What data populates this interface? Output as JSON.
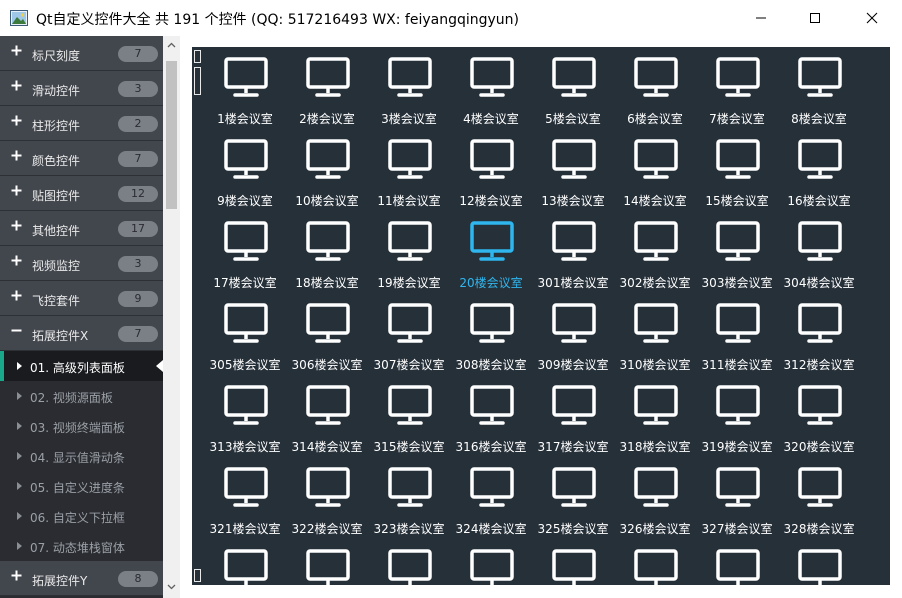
{
  "window": {
    "title": "Qt自定义控件大全 共 191 个控件 (QQ: 517216493 WX: feiyangqingyun)",
    "icon": "app-image-icon",
    "controls": [
      "minimize-icon",
      "maximize-icon",
      "close-icon"
    ]
  },
  "sidebar": {
    "groups_top": [
      {
        "label": "标尺刻度",
        "count": "7",
        "sign": "+"
      },
      {
        "label": "滑动控件",
        "count": "3",
        "sign": "+"
      },
      {
        "label": "柱形控件",
        "count": "2",
        "sign": "+"
      },
      {
        "label": "颜色控件",
        "count": "7",
        "sign": "+"
      },
      {
        "label": "贴图控件",
        "count": "12",
        "sign": "+"
      },
      {
        "label": "其他控件",
        "count": "17",
        "sign": "+"
      },
      {
        "label": "视频监控",
        "count": "3",
        "sign": "+"
      },
      {
        "label": "飞控套件",
        "count": "9",
        "sign": "+"
      },
      {
        "label": "拓展控件X",
        "count": "7",
        "sign": "−"
      }
    ],
    "sub_items": [
      {
        "label": "01. 高级列表面板",
        "active": true
      },
      {
        "label": "02. 视频源面板",
        "active": false
      },
      {
        "label": "03. 视频终端面板",
        "active": false
      },
      {
        "label": "04. 显示值滑动条",
        "active": false
      },
      {
        "label": "05. 自定义进度条",
        "active": false
      },
      {
        "label": "06. 自定义下拉框",
        "active": false
      },
      {
        "label": "07. 动态堆栈窗体",
        "active": false
      }
    ],
    "groups_bottom": [
      {
        "label": "拓展控件Y",
        "count": "8",
        "sign": "+"
      }
    ]
  },
  "content": {
    "icon": "monitor-icon",
    "icon_color": "#ffffff",
    "active_color": "#2fb6ee",
    "items": [
      {
        "label": "1楼会议室"
      },
      {
        "label": "2楼会议室"
      },
      {
        "label": "3楼会议室"
      },
      {
        "label": "4楼会议室"
      },
      {
        "label": "5楼会议室"
      },
      {
        "label": "6楼会议室"
      },
      {
        "label": "7楼会议室"
      },
      {
        "label": "8楼会议室"
      },
      {
        "label": "9楼会议室"
      },
      {
        "label": "10楼会议室"
      },
      {
        "label": "11楼会议室"
      },
      {
        "label": "12楼会议室"
      },
      {
        "label": "13楼会议室"
      },
      {
        "label": "14楼会议室"
      },
      {
        "label": "15楼会议室"
      },
      {
        "label": "16楼会议室"
      },
      {
        "label": "17楼会议室"
      },
      {
        "label": "18楼会议室"
      },
      {
        "label": "19楼会议室"
      },
      {
        "label": "20楼会议室",
        "active": true
      },
      {
        "label": "301楼会议室"
      },
      {
        "label": "302楼会议室"
      },
      {
        "label": "303楼会议室"
      },
      {
        "label": "304楼会议室"
      },
      {
        "label": "305楼会议室"
      },
      {
        "label": "306楼会议室"
      },
      {
        "label": "307楼会议室"
      },
      {
        "label": "308楼会议室"
      },
      {
        "label": "309楼会议室"
      },
      {
        "label": "310楼会议室"
      },
      {
        "label": "311楼会议室"
      },
      {
        "label": "312楼会议室"
      },
      {
        "label": "313楼会议室"
      },
      {
        "label": "314楼会议室"
      },
      {
        "label": "315楼会议室"
      },
      {
        "label": "316楼会议室"
      },
      {
        "label": "317楼会议室"
      },
      {
        "label": "318楼会议室"
      },
      {
        "label": "319楼会议室"
      },
      {
        "label": "320楼会议室"
      },
      {
        "label": "321楼会议室"
      },
      {
        "label": "322楼会议室"
      },
      {
        "label": "323楼会议室"
      },
      {
        "label": "324楼会议室"
      },
      {
        "label": "325楼会议室"
      },
      {
        "label": "326楼会议室"
      },
      {
        "label": "327楼会议室"
      },
      {
        "label": "328楼会议室"
      },
      {
        "label": ""
      },
      {
        "label": ""
      },
      {
        "label": ""
      },
      {
        "label": ""
      },
      {
        "label": ""
      },
      {
        "label": ""
      },
      {
        "label": ""
      },
      {
        "label": ""
      }
    ]
  }
}
